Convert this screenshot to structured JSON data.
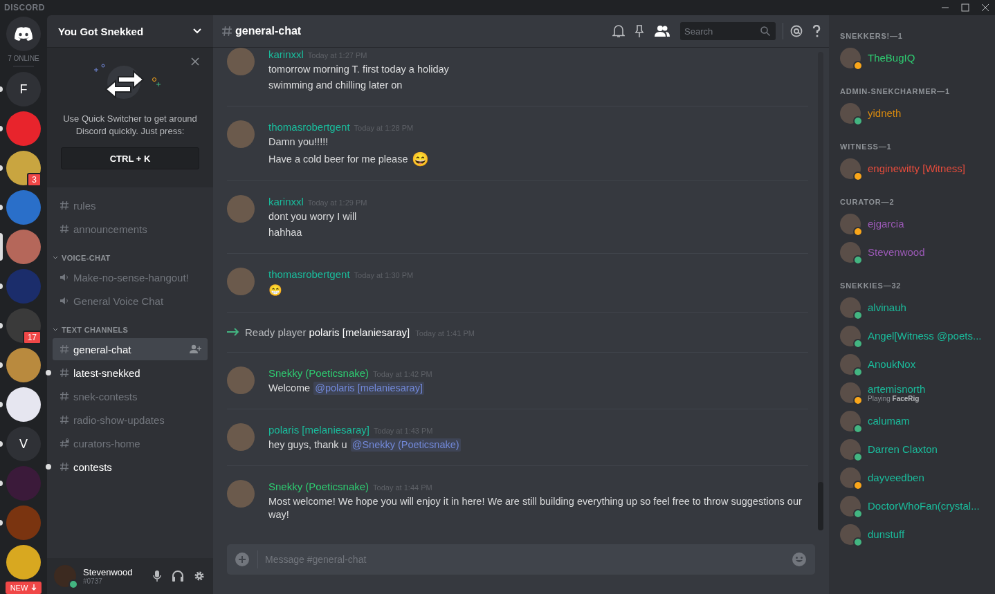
{
  "app_logo": "DISCORD",
  "servers_online": "7 ONLINE",
  "servers": [
    {
      "kind": "home",
      "unread": false,
      "selected": false
    },
    {
      "kind": "letter",
      "label": "F",
      "unread": true,
      "selected": false
    },
    {
      "kind": "image",
      "color": "#e8242c",
      "unread": true,
      "selected": false
    },
    {
      "kind": "image",
      "color": "#c9a540",
      "badge": "3",
      "unread": true,
      "selected": false
    },
    {
      "kind": "image",
      "color": "#2a6fc9",
      "unread": true,
      "selected": false
    },
    {
      "kind": "image",
      "color": "#b5675a",
      "unread": false,
      "selected": true
    },
    {
      "kind": "image",
      "color": "#1b2d6b",
      "unread": true,
      "selected": false
    },
    {
      "kind": "image",
      "color": "#3a3a3a",
      "badge": "17",
      "unread": true,
      "selected": false
    },
    {
      "kind": "image",
      "color": "#b98a3e",
      "unread": true,
      "selected": false
    },
    {
      "kind": "image",
      "color": "#e6e6f0",
      "unread": true,
      "selected": false
    },
    {
      "kind": "letter",
      "label": "V",
      "unread": true,
      "selected": false
    },
    {
      "kind": "image",
      "color": "#3b1a3a",
      "unread": true,
      "selected": false
    },
    {
      "kind": "image",
      "color": "#7a3410",
      "unread": true,
      "selected": false
    },
    {
      "kind": "image",
      "color": "#d8a820",
      "unread": false,
      "selected": false
    }
  ],
  "new_pill": "NEW",
  "guild": {
    "name": "You Got Snekked"
  },
  "quick_switcher": {
    "text": "Use Quick Switcher to get around Discord quickly. Just press:",
    "shortcut": "CTRL + K"
  },
  "channel_groups": [
    {
      "channels": [
        {
          "kind": "text",
          "name": "rules",
          "selected": false,
          "unread": false
        },
        {
          "kind": "text",
          "name": "announcements",
          "selected": false,
          "unread": false
        }
      ]
    },
    {
      "name": "VOICE-CHAT",
      "channels": [
        {
          "kind": "voice",
          "name": "Make-no-sense-hangout!",
          "selected": false,
          "unread": false
        },
        {
          "kind": "voice",
          "name": "General Voice Chat",
          "selected": false,
          "unread": false
        }
      ]
    },
    {
      "name": "TEXT CHANNELS",
      "channels": [
        {
          "kind": "text",
          "name": "general-chat",
          "selected": true,
          "unread": false
        },
        {
          "kind": "text",
          "name": "latest-snekked",
          "selected": false,
          "unread": true
        },
        {
          "kind": "text",
          "name": "snek-contests",
          "selected": false,
          "unread": false
        },
        {
          "kind": "text",
          "name": "radio-show-updates",
          "selected": false,
          "unread": false
        },
        {
          "kind": "locked",
          "name": "curators-home",
          "selected": false,
          "unread": false
        },
        {
          "kind": "text",
          "name": "contests",
          "selected": false,
          "unread": true
        }
      ]
    }
  ],
  "user": {
    "name": "Stevenwood",
    "tag": "#0737",
    "idle": false
  },
  "channel": {
    "name": "general-chat"
  },
  "search": {
    "placeholder": "Search"
  },
  "messages": [
    {
      "kind": "message",
      "author": "karinxxl",
      "color": "#1abc9c",
      "time": "Today at 1:27 PM",
      "lines": [
        {
          "text": "tomorrow morning T. first today a holiday"
        },
        {
          "text": "swimming and chilling later on"
        }
      ]
    },
    {
      "kind": "message",
      "author": "thomasrobertgent",
      "color": "#1abc9c",
      "time": "Today at 1:28 PM",
      "lines": [
        {
          "text": "Damn you!!!!!"
        },
        {
          "text": "Have a cold beer for me please",
          "emoji": "😄"
        }
      ]
    },
    {
      "kind": "message",
      "author": "karinxxl",
      "color": "#1abc9c",
      "time": "Today at 1:29 PM",
      "lines": [
        {
          "text": "dont you worry I will"
        },
        {
          "text": "hahhaa"
        }
      ]
    },
    {
      "kind": "message",
      "author": "thomasrobertgent",
      "color": "#1abc9c",
      "time": "Today at 1:30 PM",
      "lines": [
        {
          "emoji": "😁"
        }
      ]
    },
    {
      "kind": "join",
      "text": "Ready player",
      "user": "polaris [melaniesaray]",
      "time": "Today at 1:41 PM"
    },
    {
      "kind": "message",
      "author": "Snekky (Poeticsnake)",
      "color": "#2ecc71",
      "time": "Today at 1:42 PM",
      "lines": [
        {
          "text": "Welcome",
          "mention": "@polaris [melaniesaray]"
        }
      ]
    },
    {
      "kind": "message",
      "author": "polaris [melaniesaray]",
      "color": "#1abc9c",
      "time": "Today at 1:43 PM",
      "lines": [
        {
          "text": "hey guys, thank u",
          "mention": "@Snekky (Poeticsnake)"
        }
      ]
    },
    {
      "kind": "message",
      "author": "Snekky (Poeticsnake)",
      "color": "#2ecc71",
      "time": "Today at 1:44 PM",
      "lines": [
        {
          "text": "Most welcome! We hope you will enjoy it in here! We are still building everything up so feel free to throw suggestions our way!"
        }
      ]
    }
  ],
  "composer": {
    "placeholder": "Message #general-chat"
  },
  "member_groups": [
    {
      "name": "SNEKKERS!—1",
      "members": [
        {
          "name": "TheBugIQ",
          "color": "#2ecc71",
          "idle": true
        }
      ]
    },
    {
      "name": "ADMIN-SNEKCHARMER—1",
      "members": [
        {
          "name": "yidneth",
          "color": "#d68910",
          "idle": false
        }
      ]
    },
    {
      "name": "WITNESS—1",
      "members": [
        {
          "name": "enginewitty [Witness]",
          "color": "#e74c3c",
          "idle": true
        }
      ]
    },
    {
      "name": "CURATOR—2",
      "members": [
        {
          "name": "ejgarcia",
          "color": "#9b59b6",
          "idle": true
        },
        {
          "name": "Stevenwood",
          "color": "#9b59b6",
          "idle": false
        }
      ]
    },
    {
      "name": "SNEKKIES—32",
      "members": [
        {
          "name": "alvinauh",
          "color": "#1abc9c",
          "idle": false
        },
        {
          "name": "Angel[Witness @poets...",
          "color": "#1abc9c",
          "idle": false
        },
        {
          "name": "AnoukNox",
          "color": "#1abc9c",
          "idle": false
        },
        {
          "name": "artemisnorth",
          "color": "#1abc9c",
          "idle": true,
          "activity": "Playing",
          "game": "FaceRig"
        },
        {
          "name": "calumam",
          "color": "#1abc9c",
          "idle": false
        },
        {
          "name": "Darren Claxton",
          "color": "#1abc9c",
          "idle": false
        },
        {
          "name": "dayveedben",
          "color": "#1abc9c",
          "idle": true
        },
        {
          "name": "DoctorWhoFan(crystal...",
          "color": "#1abc9c",
          "idle": false
        },
        {
          "name": "dunstuff",
          "color": "#1abc9c",
          "idle": false
        }
      ]
    }
  ]
}
